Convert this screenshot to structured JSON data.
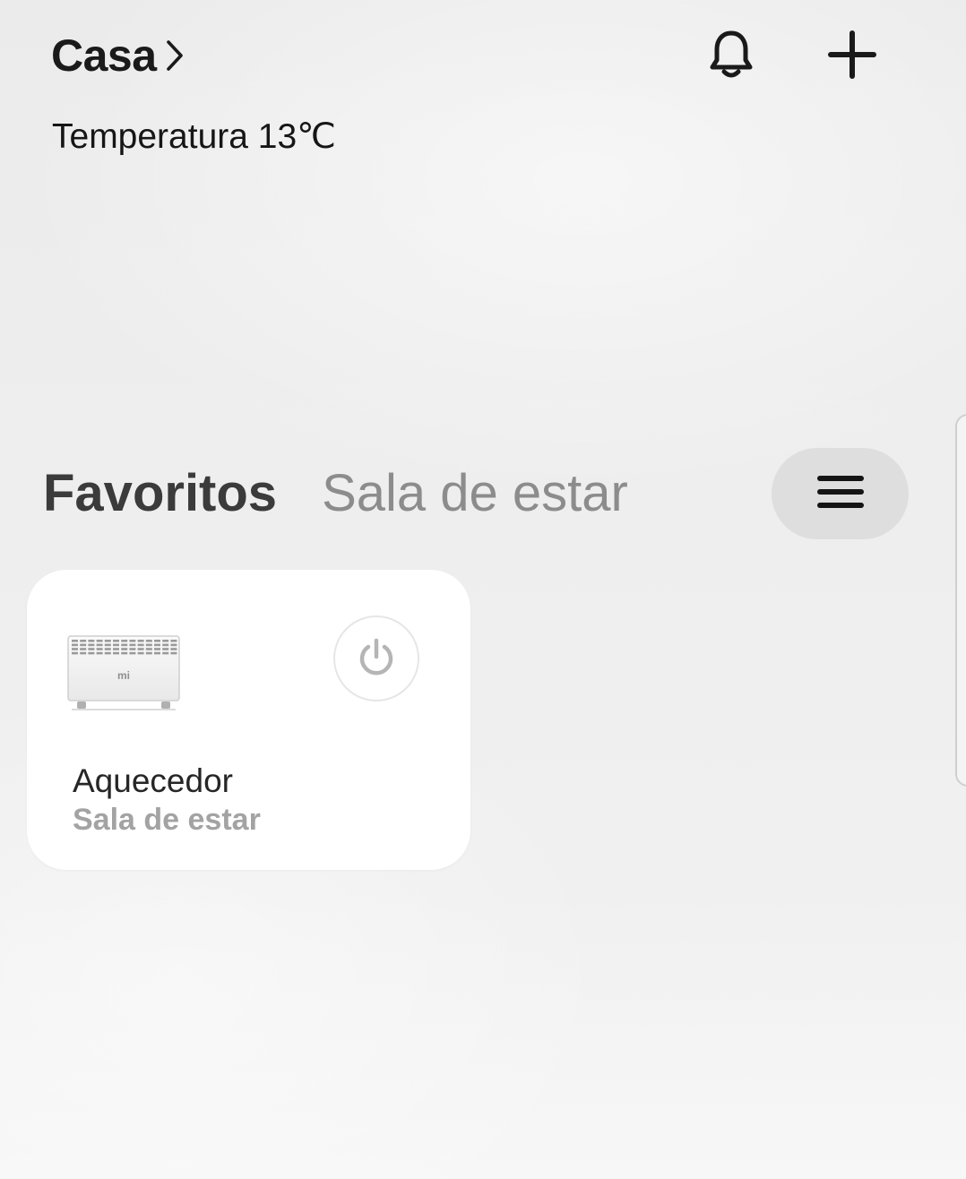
{
  "header": {
    "home_name": "Casa",
    "temperature": "Temperatura 13℃",
    "icons": [
      "chevron-right-icon",
      "bell-icon",
      "plus-icon"
    ]
  },
  "tabs": [
    {
      "label": "Favoritos",
      "active": true
    },
    {
      "label": "Sala de estar",
      "active": false
    }
  ],
  "menu_icon": "hamburger-menu-icon",
  "devices": [
    {
      "name": "Aquecedor",
      "room": "Sala de estar",
      "logo_text": "mi",
      "image_icon": "heater-icon",
      "power_icon": "power-icon",
      "power_on": false
    }
  ],
  "colors": {
    "background": "#eeeeee",
    "card": "#ffffff",
    "tab_active": "#3b3b3b",
    "tab_inactive": "#8c8c8c",
    "menu_pill": "#dedede",
    "power_icon": "#b5b5b5",
    "room_text": "#a3a3a3"
  }
}
